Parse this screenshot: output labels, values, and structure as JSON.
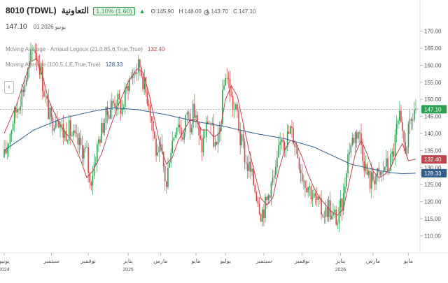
{
  "header": {
    "symbol": "8010 (TDWL)",
    "name": "التعاونية",
    "change_badge": "1.10% (1.60)",
    "ohlc": {
      "o_label": "O",
      "o": "145.90",
      "h_label": "H",
      "h": "148.00",
      "l_label": "L",
      "l": "143.70",
      "c_label": "C",
      "c": "147.10"
    },
    "last_price": "147.10",
    "last_date": "01 يونيو 2026",
    "settings_icon": "gear-icon",
    "collapse_icon": "chevron-left-icon"
  },
  "indicators": [
    {
      "label": "Moving Average - Arnaud Legoux (21,0.85,6,True,True)",
      "value": "132.40",
      "color": "#c0454f"
    },
    {
      "label": "Moving Average (100,5,1,E,True,True)",
      "value": "128.33",
      "color": "#2f5e8f"
    }
  ],
  "colors": {
    "up": "#2e9e4f",
    "down": "#d04a4a",
    "alma": "#c0454f",
    "ema": "#2f5e8f",
    "grid": "#eeeeee",
    "axis_text": "#555555"
  },
  "chart_data": {
    "type": "candlestick",
    "y_ticks": [
      "110.00",
      "115.00",
      "120.00",
      "125.00",
      "130.00",
      "135.00",
      "140.00",
      "145.00",
      "150.00",
      "155.00",
      "160.00",
      "165.00",
      "170.00"
    ],
    "ylim": [
      107,
      173
    ],
    "last_price_label": "147.10",
    "alma_label": "132.40",
    "ema_label": "128.33",
    "x_ticks": [
      {
        "label": "يونيو",
        "sub": "2024"
      },
      {
        "label": "سبتمبر",
        "sub": ""
      },
      {
        "label": "نوفمبر",
        "sub": ""
      },
      {
        "label": "يناير",
        "sub": "2025"
      },
      {
        "label": "مارس",
        "sub": ""
      },
      {
        "label": "مايو",
        "sub": ""
      },
      {
        "label": "يوليو",
        "sub": ""
      },
      {
        "label": "سبتمبر",
        "sub": ""
      },
      {
        "label": "نوفمبر",
        "sub": ""
      },
      {
        "label": "يناير",
        "sub": "2026"
      },
      {
        "label": "مارس",
        "sub": ""
      },
      {
        "label": "مايو",
        "sub": ""
      }
    ],
    "x_tick_bars": [
      0,
      32,
      57,
      84,
      106,
      130,
      150,
      176,
      202,
      228,
      250,
      274
    ],
    "price_path": [
      [
        0,
        133
      ],
      [
        6,
        144
      ],
      [
        12,
        152
      ],
      [
        16,
        158
      ],
      [
        20,
        166
      ],
      [
        24,
        160
      ],
      [
        28,
        150
      ],
      [
        32,
        143
      ],
      [
        36,
        146
      ],
      [
        40,
        140
      ],
      [
        44,
        141
      ],
      [
        48,
        138
      ],
      [
        52,
        136
      ],
      [
        56,
        134
      ],
      [
        58,
        125
      ],
      [
        60,
        129
      ],
      [
        64,
        138
      ],
      [
        68,
        144
      ],
      [
        72,
        148
      ],
      [
        76,
        150
      ],
      [
        80,
        147
      ],
      [
        84,
        155
      ],
      [
        88,
        158
      ],
      [
        92,
        160
      ],
      [
        94,
        156
      ],
      [
        96,
        152
      ],
      [
        98,
        150
      ],
      [
        100,
        144
      ],
      [
        102,
        138
      ],
      [
        104,
        132
      ],
      [
        106,
        135
      ],
      [
        108,
        130
      ],
      [
        110,
        124
      ],
      [
        112,
        134
      ],
      [
        114,
        138
      ],
      [
        116,
        142
      ],
      [
        118,
        144
      ],
      [
        120,
        140
      ],
      [
        122,
        140
      ],
      [
        124,
        147
      ],
      [
        126,
        143
      ],
      [
        128,
        146
      ],
      [
        130,
        146
      ],
      [
        132,
        138
      ],
      [
        134,
        136
      ],
      [
        136,
        140
      ],
      [
        138,
        144
      ],
      [
        140,
        143
      ],
      [
        142,
        138
      ],
      [
        144,
        135
      ],
      [
        146,
        140
      ],
      [
        148,
        150
      ],
      [
        150,
        158
      ],
      [
        152,
        155
      ],
      [
        154,
        150
      ],
      [
        156,
        147
      ],
      [
        158,
        146
      ],
      [
        160,
        138
      ],
      [
        162,
        136
      ],
      [
        164,
        131
      ],
      [
        166,
        130
      ],
      [
        168,
        127
      ],
      [
        170,
        124
      ],
      [
        172,
        121
      ],
      [
        174,
        117
      ],
      [
        176,
        118
      ],
      [
        178,
        120
      ],
      [
        180,
        124
      ],
      [
        182,
        126
      ],
      [
        184,
        128
      ],
      [
        186,
        134
      ],
      [
        188,
        140
      ],
      [
        190,
        138
      ],
      [
        192,
        139
      ],
      [
        194,
        141
      ],
      [
        196,
        139
      ],
      [
        198,
        136
      ],
      [
        200,
        132
      ],
      [
        202,
        128
      ],
      [
        204,
        126
      ],
      [
        206,
        125
      ],
      [
        208,
        123
      ],
      [
        210,
        121
      ],
      [
        212,
        120
      ],
      [
        214,
        118
      ],
      [
        216,
        117
      ],
      [
        218,
        117
      ],
      [
        220,
        119
      ],
      [
        222,
        115
      ],
      [
        224,
        116
      ],
      [
        226,
        114
      ],
      [
        228,
        118
      ],
      [
        230,
        121
      ],
      [
        232,
        131
      ],
      [
        234,
        136
      ],
      [
        236,
        138
      ],
      [
        238,
        140
      ],
      [
        240,
        141
      ],
      [
        242,
        137
      ],
      [
        244,
        132
      ],
      [
        246,
        128
      ],
      [
        248,
        126
      ],
      [
        250,
        127
      ],
      [
        252,
        128
      ],
      [
        254,
        127
      ],
      [
        256,
        128
      ],
      [
        258,
        131
      ],
      [
        260,
        130
      ],
      [
        262,
        132
      ],
      [
        264,
        135
      ],
      [
        266,
        141
      ],
      [
        268,
        144
      ],
      [
        270,
        138
      ],
      [
        272,
        136
      ],
      [
        274,
        140
      ],
      [
        276,
        143
      ],
      [
        278,
        147
      ]
    ],
    "ema_path": [
      [
        0,
        135
      ],
      [
        20,
        141
      ],
      [
        40,
        144.5
      ],
      [
        60,
        146.5
      ],
      [
        74,
        147.5
      ],
      [
        90,
        147
      ],
      [
        110,
        145.5
      ],
      [
        130,
        143.5
      ],
      [
        150,
        142
      ],
      [
        170,
        140
      ],
      [
        190,
        138.5
      ],
      [
        210,
        136
      ],
      [
        225,
        133
      ],
      [
        235,
        131
      ],
      [
        250,
        129.5
      ],
      [
        262,
        128.5
      ],
      [
        270,
        128.2
      ],
      [
        278,
        128.33
      ]
    ],
    "alma_path": [
      [
        0,
        140
      ],
      [
        8,
        148
      ],
      [
        14,
        156
      ],
      [
        18,
        161
      ],
      [
        22,
        162
      ],
      [
        26,
        157
      ],
      [
        30,
        150
      ],
      [
        34,
        146
      ],
      [
        40,
        141
      ],
      [
        46,
        138
      ],
      [
        52,
        132
      ],
      [
        56,
        127
      ],
      [
        60,
        129
      ],
      [
        66,
        134
      ],
      [
        72,
        142
      ],
      [
        78,
        149
      ],
      [
        84,
        155
      ],
      [
        90,
        159
      ],
      [
        94,
        158
      ],
      [
        98,
        152
      ],
      [
        102,
        144
      ],
      [
        106,
        136
      ],
      [
        110,
        131
      ],
      [
        114,
        133
      ],
      [
        118,
        138
      ],
      [
        122,
        141
      ],
      [
        126,
        144
      ],
      [
        130,
        144
      ],
      [
        134,
        141
      ],
      [
        138,
        141
      ],
      [
        142,
        139
      ],
      [
        146,
        140
      ],
      [
        150,
        150
      ],
      [
        154,
        154
      ],
      [
        158,
        151
      ],
      [
        162,
        143
      ],
      [
        166,
        135
      ],
      [
        170,
        128
      ],
      [
        174,
        121
      ],
      [
        178,
        119
      ],
      [
        182,
        121
      ],
      [
        186,
        129
      ],
      [
        190,
        135
      ],
      [
        194,
        138
      ],
      [
        198,
        137
      ],
      [
        202,
        133
      ],
      [
        206,
        128
      ],
      [
        210,
        124
      ],
      [
        214,
        121
      ],
      [
        218,
        119
      ],
      [
        222,
        117
      ],
      [
        226,
        116
      ],
      [
        230,
        118
      ],
      [
        234,
        126
      ],
      [
        238,
        134
      ],
      [
        242,
        138
      ],
      [
        246,
        134
      ],
      [
        250,
        129
      ],
      [
        254,
        127
      ],
      [
        258,
        128
      ],
      [
        262,
        130
      ],
      [
        266,
        134
      ],
      [
        270,
        137
      ],
      [
        274,
        132
      ],
      [
        278,
        132.4
      ]
    ]
  }
}
